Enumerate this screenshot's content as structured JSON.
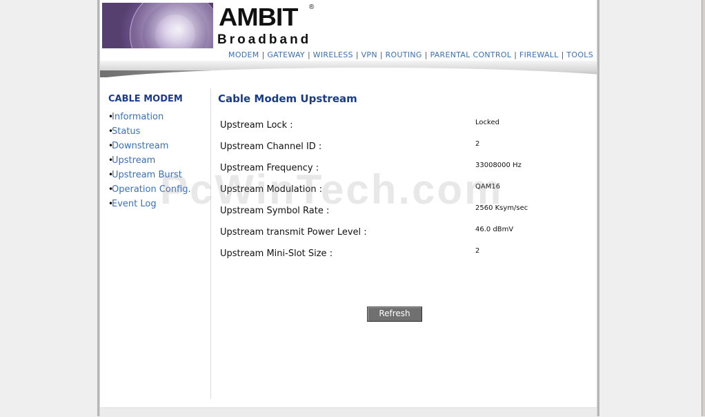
{
  "header": {
    "logo_main": "AMBIT",
    "logo_reg": "®",
    "logo_sub": "Broadband"
  },
  "topnav": {
    "items": [
      "MODEM",
      "GATEWAY",
      "WIRELESS",
      "VPN",
      "ROUTING",
      "PARENTAL CONTROL",
      "FIREWALL",
      "TOOLS"
    ]
  },
  "sidebar": {
    "title": "CABLE MODEM",
    "items": [
      {
        "label": "Information"
      },
      {
        "label": "Status"
      },
      {
        "label": "Downstream"
      },
      {
        "label": "Upstream"
      },
      {
        "label": "Upstream Burst"
      },
      {
        "label": "Operation Config."
      },
      {
        "label": "Event Log"
      }
    ]
  },
  "main": {
    "title": "Cable Modem Upstream",
    "rows": [
      {
        "label": "Upstream Lock :",
        "value": "Locked"
      },
      {
        "label": "Upstream Channel ID :",
        "value": "2"
      },
      {
        "label": "Upstream Frequency :",
        "value": "33008000 Hz"
      },
      {
        "label": "Upstream Modulation :",
        "value": "QAM16"
      },
      {
        "label": "Upstream Symbol Rate :",
        "value": "2560 Ksym/sec"
      },
      {
        "label": "Upstream transmit Power Level :",
        "value": "46.0 dBmV"
      },
      {
        "label": "Upstream Mini-Slot Size :",
        "value": "2"
      }
    ],
    "refresh_label": "Refresh"
  },
  "watermark": "PcWinTech.com",
  "colors": {
    "link": "#3b6fb6",
    "heading": "#1a3a8c",
    "button": "#707070"
  }
}
